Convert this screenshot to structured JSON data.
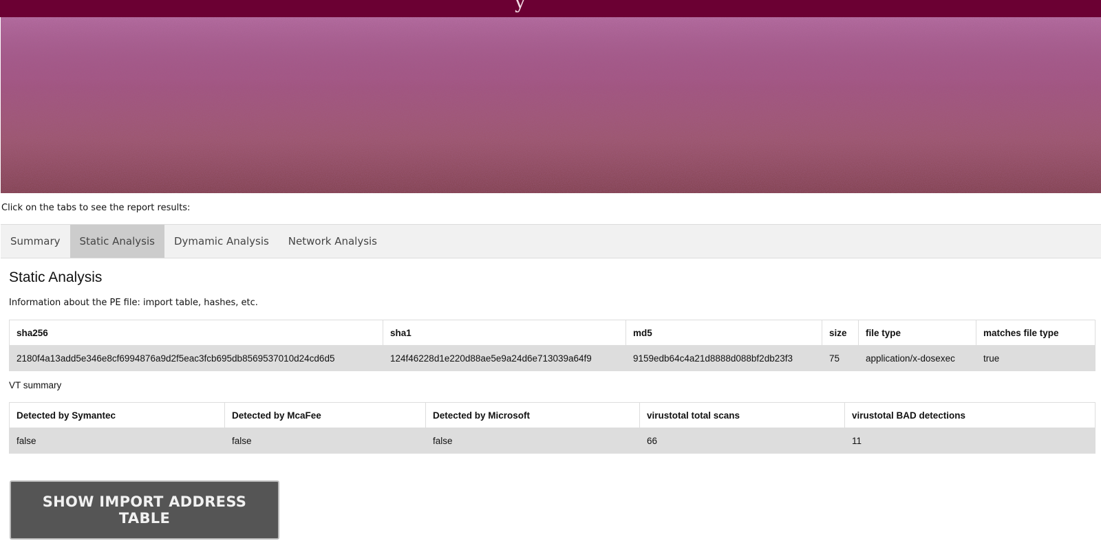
{
  "header": {
    "title_glyph": "y"
  },
  "intro_text": "Click on the tabs to see the report results:",
  "tabs": [
    {
      "label": "Summary",
      "active": false
    },
    {
      "label": "Static Analysis",
      "active": true
    },
    {
      "label": "Dymamic Analysis",
      "active": false
    },
    {
      "label": "Network Analysis",
      "active": false
    }
  ],
  "static": {
    "title": "Static Analysis",
    "description": "Information about the PE file: import table, hashes, etc.",
    "pe_table": {
      "headers": [
        "sha256",
        "sha1",
        "md5",
        "size",
        "file type",
        "matches file type"
      ],
      "row": [
        "2180f4a13add5e346e8cf6994876a9d2f5eac3fcb695db8569537010d24cd6d5",
        "124f46228d1e220d88ae5e9a24d6e713039a64f9",
        "9159edb64c4a21d8888d088bf2db23f3",
        "75",
        "application/x-dosexec",
        "true"
      ]
    },
    "vt_label": "VT summary",
    "vt_table": {
      "headers": [
        "Detected by Symantec",
        "Detected by McaFee",
        "Detected by Microsoft",
        "virustotal total scans",
        "virustotal BAD detections"
      ],
      "row": [
        "false",
        "false",
        "false",
        "66",
        "11"
      ]
    },
    "iat_button_label": "SHOW IMPORT ADDRESS TABLE"
  },
  "colors": {
    "header_bar": "#6b0033",
    "tab_active": "#cccccc",
    "button_bg": "#555555"
  }
}
